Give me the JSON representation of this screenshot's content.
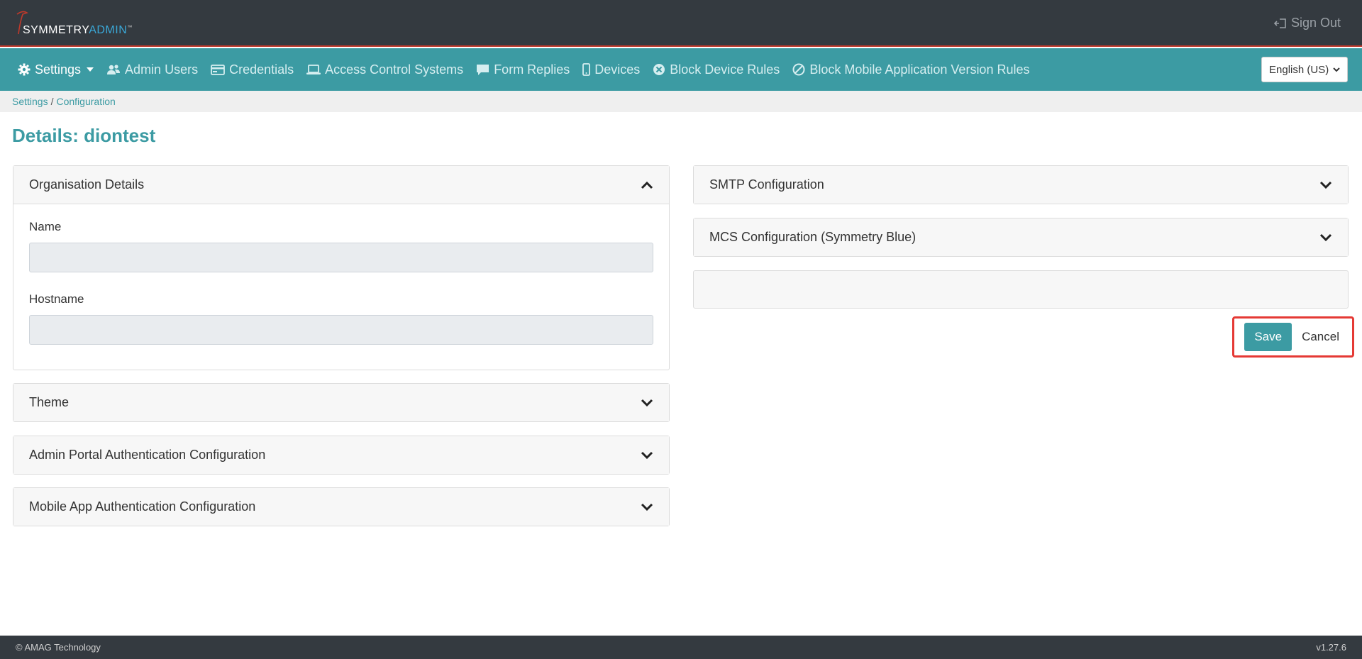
{
  "header": {
    "logo_brand": "SYMMETRY",
    "logo_suffix": "ADMIN",
    "logo_tm": "™",
    "signout_label": "Sign Out"
  },
  "nav": {
    "items": [
      {
        "label": "Settings",
        "icon": "gear-icon",
        "active": true
      },
      {
        "label": "Admin Users",
        "icon": "users-icon"
      },
      {
        "label": "Credentials",
        "icon": "credential-card-icon"
      },
      {
        "label": "Access Control Systems",
        "icon": "laptop-icon"
      },
      {
        "label": "Form Replies",
        "icon": "comment-icon"
      },
      {
        "label": "Devices",
        "icon": "mobile-icon"
      },
      {
        "label": "Block Device Rules",
        "icon": "times-circle-icon"
      },
      {
        "label": "Block Mobile Application Version Rules",
        "icon": "ban-icon"
      }
    ],
    "language_selected": "English (US)"
  },
  "breadcrumb": {
    "items": [
      "Settings",
      "Configuration"
    ],
    "separator": "/"
  },
  "page": {
    "title": "Details: diontest"
  },
  "left_panels": {
    "organisation": {
      "title": "Organisation Details",
      "expanded": true,
      "name_label": "Name",
      "name_value": "",
      "hostname_label": "Hostname",
      "hostname_value": ""
    },
    "theme": {
      "title": "Theme"
    },
    "admin_auth": {
      "title": "Admin Portal Authentication Configuration"
    },
    "mobile_auth": {
      "title": "Mobile App Authentication Configuration"
    }
  },
  "right_panels": {
    "smtp": {
      "title": "SMTP Configuration"
    },
    "mcs": {
      "title": "MCS Configuration (Symmetry Blue)"
    }
  },
  "actions": {
    "save_label": "Save",
    "cancel_label": "Cancel"
  },
  "footer": {
    "copyright": "© AMAG Technology",
    "version": "v1.27.6"
  },
  "colors": {
    "header_bg": "#343a40",
    "nav_bg": "#3c9ba3",
    "accent": "#3c9ba3",
    "highlight_border": "#e53935"
  }
}
